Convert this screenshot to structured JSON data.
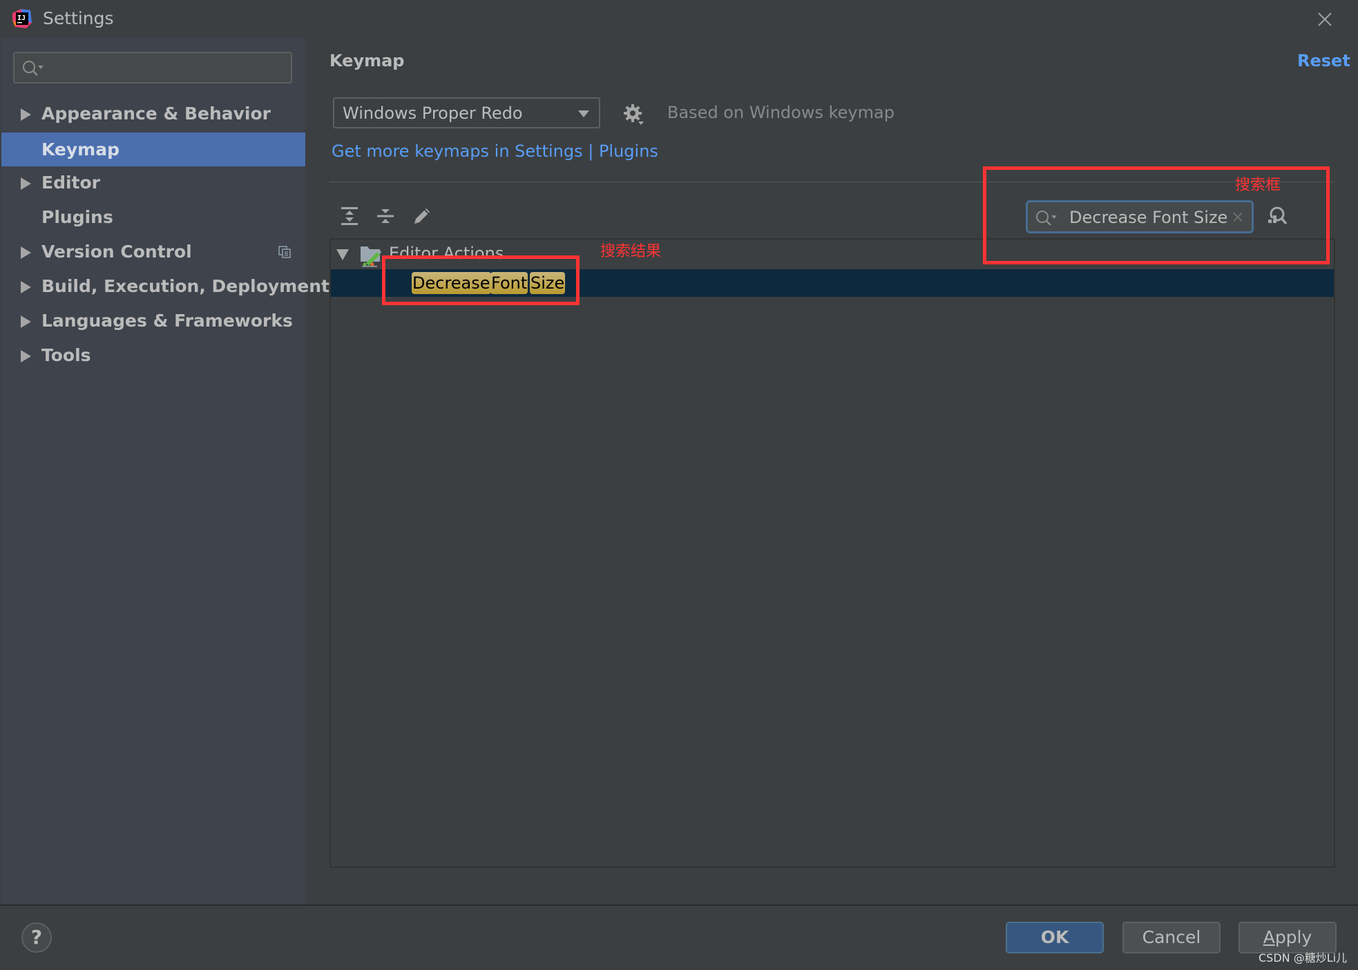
{
  "window": {
    "title": "Settings",
    "app_icon": "intellij-idea-logo",
    "close_icon": "close-icon"
  },
  "sidebar": {
    "search": {
      "value": "",
      "placeholder": ""
    },
    "items": [
      {
        "label": "Appearance & Behavior",
        "expandable": true,
        "selected": false
      },
      {
        "label": "Keymap",
        "expandable": false,
        "selected": true
      },
      {
        "label": "Editor",
        "expandable": true,
        "selected": false
      },
      {
        "label": "Plugins",
        "expandable": false,
        "selected": false
      },
      {
        "label": "Version Control",
        "expandable": true,
        "selected": false,
        "badge_icon": "project-level-icon"
      },
      {
        "label": "Build, Execution, Deployment",
        "expandable": true,
        "selected": false
      },
      {
        "label": "Languages & Frameworks",
        "expandable": true,
        "selected": false
      },
      {
        "label": "Tools",
        "expandable": true,
        "selected": false
      }
    ]
  },
  "main": {
    "title": "Keymap",
    "reset_label": "Reset",
    "keymap_select": {
      "value": "Windows Proper Redo"
    },
    "based_on": "Based on Windows keymap",
    "plugins_link": "Get more keymaps in Settings | Plugins",
    "toolbar": {
      "expand_all": "expand-all-icon",
      "collapse_all": "collapse-all-icon",
      "edit": "edit-icon"
    },
    "search_field": {
      "value": "Decrease Font Size",
      "clear_icon": "×"
    },
    "find_by_shortcut": "find-by-shortcut-icon",
    "tree": {
      "group": "Editor Actions",
      "result_words": [
        "Decrease",
        "Font",
        "Size"
      ]
    }
  },
  "annotations": {
    "search_box_label": "搜索框",
    "search_result_label": "搜索结果",
    "color": "#ff3333"
  },
  "footer": {
    "help_label": "?",
    "ok_label": "OK",
    "cancel_label": "Cancel",
    "apply_label": "Apply",
    "apply_mnemonic": "A",
    "apply_rest": "pply"
  },
  "watermark": "CSDN @糖炒Li儿",
  "colors": {
    "accent": "#589df6",
    "selection": "#4b6eaf",
    "tree_selection": "#0d293e",
    "highlight": "#c3a84a",
    "default_button": "#365880"
  }
}
